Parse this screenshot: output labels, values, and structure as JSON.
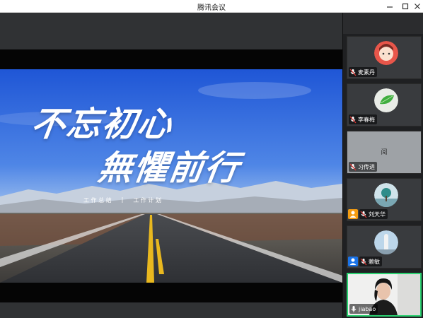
{
  "window": {
    "title": "腾讯会议",
    "minimize": "—",
    "maximize": "☐",
    "close": "✕"
  },
  "slide": {
    "headline_line1": "不忘初心",
    "headline_line2": "無懼前行",
    "subtitle_left": "工 作 总 结",
    "subtitle_sep": "|",
    "subtitle_right": "工 作 计 划"
  },
  "participants": [
    {
      "name": "麦素丹",
      "avatar_icon": "cartoon-avatar-icon",
      "host": false
    },
    {
      "name": "李春梅",
      "avatar_icon": "leaf-avatar-icon",
      "host": false
    },
    {
      "name": "习传进",
      "avatar_text": "阅",
      "host": false
    },
    {
      "name": "刘天华",
      "avatar_icon": "tree-avatar-icon",
      "host": true
    },
    {
      "name": "赖敏",
      "avatar_icon": "statue-avatar-icon",
      "host": true
    },
    {
      "name": "jiabao",
      "avatar_icon": "camera-video-feed",
      "host": false,
      "speaking": true
    }
  ],
  "colors": {
    "accent": "#2bd170",
    "host_badge": "#f39c12",
    "host_badge_alt": "#1a73e8",
    "mic_muted": "#e53935"
  }
}
